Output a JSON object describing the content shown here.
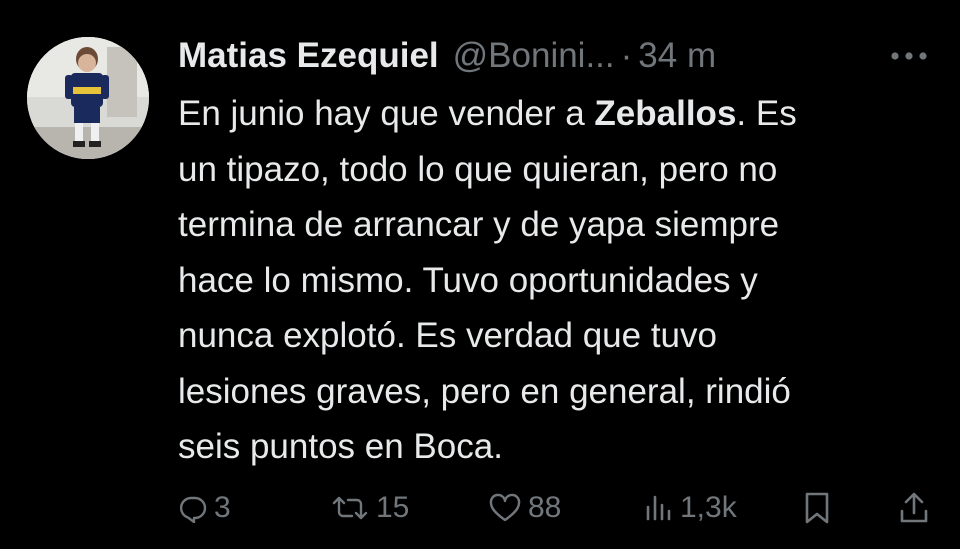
{
  "author": {
    "name": "Matias Ezequiel",
    "handle": "@Bonini...",
    "separator": "·",
    "time": "34 m"
  },
  "tweet": {
    "lines": [
      {
        "before": "En junio hay que vender a ",
        "bold": "Zeballos",
        "after": ". Es"
      },
      {
        "text": "un tipazo, todo lo que quieran, pero no"
      },
      {
        "text": "termina de arrancar y de yapa siempre"
      },
      {
        "text": "hace lo mismo. Tuvo oportunidades y"
      },
      {
        "text": "nunca explotó. Es verdad que tuvo"
      },
      {
        "text": "lesiones graves, pero en general, rindió"
      },
      {
        "text": "seis puntos en Boca."
      }
    ]
  },
  "actions": {
    "replies": "3",
    "reposts": "15",
    "likes": "88",
    "views": "1,3k"
  },
  "icons": {
    "more": "more-horizontal-icon",
    "reply": "reply-icon",
    "repost": "repost-icon",
    "like": "heart-icon",
    "views": "analytics-icon",
    "bookmark": "bookmark-icon",
    "share": "share-icon"
  },
  "colors": {
    "background": "#000000",
    "text": "#e7e9ea",
    "muted": "#71767b"
  }
}
